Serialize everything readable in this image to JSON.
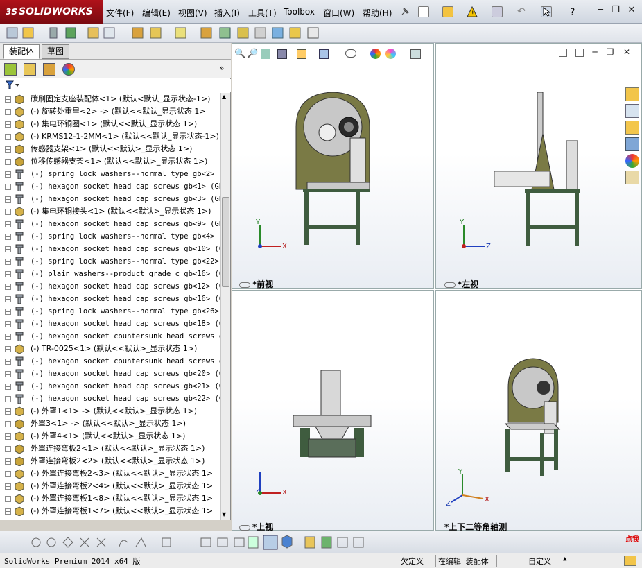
{
  "app": {
    "logo_prefix": "3S",
    "logo_name": "SOLIDWORKS"
  },
  "menu": [
    "文件(F)",
    "编辑(E)",
    "视图(V)",
    "插入(I)",
    "工具(T)",
    "Toolbox",
    "窗口(W)",
    "帮助(H)"
  ],
  "help_glyph": "?",
  "tabs": [
    "装配体",
    "草图"
  ],
  "tree": [
    {
      "label": "碳刷固定支座装配体<1> (默认<默认_显示状态-1>)",
      "icon": "assembly",
      "mono": false
    },
    {
      "label": "(-) 旋转处重里<2> -> (默认<<默认_显示状态 1>",
      "icon": "part",
      "mono": false
    },
    {
      "label": "(-) 集电环铜圈<1> (默认<<默认_显示状态 1>)",
      "icon": "part",
      "mono": false
    },
    {
      "label": "(-) KRMS12-1-2MM<1> (默认<<默认_显示状态-1>)",
      "icon": "part",
      "mono": false
    },
    {
      "label": "传感器支架<1> (默认<<默认>_显示状态 1>)",
      "icon": "assembly",
      "mono": false
    },
    {
      "label": "位移传感器支架<1> (默认<<默认>_显示状态 1>)",
      "icon": "assembly",
      "mono": false
    },
    {
      "label": "(-) spring lock washers--normal type gb<2> (GB",
      "icon": "screw",
      "mono": true
    },
    {
      "label": "(-) hexagon socket head cap screws gb<1> (GB_I",
      "icon": "screw",
      "mono": true
    },
    {
      "label": "(-) hexagon socket head cap screws gb<3> (GB_I",
      "icon": "screw",
      "mono": true
    },
    {
      "label": "(-) 集电环铜接头<1> (默认<<默认>_显示状态 1>)",
      "icon": "part",
      "mono": false
    },
    {
      "label": "(-) hexagon socket head cap screws gb<9> (GB_I",
      "icon": "screw",
      "mono": true
    },
    {
      "label": "(-) spring lock washers--normal type gb<4> (GI",
      "icon": "screw",
      "mono": true
    },
    {
      "label": "(-) hexagon socket head cap screws gb<10> (GB_",
      "icon": "screw",
      "mono": true
    },
    {
      "label": "(-) spring lock washers--normal type gb<22> (",
      "icon": "screw",
      "mono": true
    },
    {
      "label": "(-) plain washers--product grade c gb<16> (GB_",
      "icon": "screw",
      "mono": true
    },
    {
      "label": "(-) hexagon socket head cap screws gb<12> (GB_",
      "icon": "screw",
      "mono": true
    },
    {
      "label": "(-) hexagon socket head cap screws gb<16> (GB_",
      "icon": "screw",
      "mono": true
    },
    {
      "label": "(-) spring lock washers--normal type gb<26> (",
      "icon": "screw",
      "mono": true
    },
    {
      "label": "(-) hexagon socket head cap screws gb<18> (GB_",
      "icon": "screw",
      "mono": true
    },
    {
      "label": "(-) hexagon socket countersunk head screws gb<",
      "icon": "screw",
      "mono": true
    },
    {
      "label": "(-) TR-0025<1> (默认<<默认>_显示状态 1>)",
      "icon": "part",
      "mono": false
    },
    {
      "label": "(-) hexagon socket countersunk head screws gb<",
      "icon": "screw",
      "mono": true
    },
    {
      "label": "(-) hexagon socket head cap screws gb<20> (GB_",
      "icon": "screw",
      "mono": true
    },
    {
      "label": "(-) hexagon socket head cap screws gb<21> (GB_",
      "icon": "screw",
      "mono": true
    },
    {
      "label": "(-) hexagon socket head cap screws gb<22> (GB_",
      "icon": "screw",
      "mono": true
    },
    {
      "label": "(-) 外罩1<1> -> (默认<<默认>_显示状态 1>)",
      "icon": "part",
      "mono": false
    },
    {
      "label": "外罩3<1> -> (默认<<默认>_显示状态 1>)",
      "icon": "assembly",
      "mono": false
    },
    {
      "label": "(-) 外罩4<1> (默认<<默认>_显示状态 1>)",
      "icon": "part",
      "mono": false
    },
    {
      "label": "外罩连接弯板2<1> (默认<<默认>_显示状态 1>)",
      "icon": "assembly",
      "mono": false
    },
    {
      "label": "外罩连接弯板2<2> (默认<<默认>_显示状态 1>)",
      "icon": "assembly",
      "mono": false
    },
    {
      "label": "(-) 外罩连接弯板2<3> (默认<<默认>_显示状态 1>",
      "icon": "part",
      "mono": false
    },
    {
      "label": "(-) 外罩连接弯板2<4> (默认<<默认>_显示状态 1>",
      "icon": "part",
      "mono": false
    },
    {
      "label": "(-) 外罩连接弯板1<8> (默认<<默认>_显示状态 1>",
      "icon": "part",
      "mono": false
    },
    {
      "label": "(-) 外罩连接弯板1<7> (默认<<默认>_显示状态 1>",
      "icon": "part",
      "mono": false
    }
  ],
  "viewports": [
    {
      "label": "*前视",
      "axes": [
        "Y",
        "X"
      ]
    },
    {
      "label": "*左视",
      "axes": [
        "Y",
        "Z"
      ]
    },
    {
      "label": "*上视",
      "axes": [
        "Z",
        "X"
      ]
    },
    {
      "label": "*上下二等角轴测",
      "axes": [
        "Y",
        "Z",
        "X"
      ]
    }
  ],
  "status": {
    "product": "SolidWorks Premium 2014 x64 版",
    "state1": "欠定义",
    "state2": "在编辑 装配体",
    "custom": "自定义",
    "corner": "点我"
  },
  "colors": {
    "brand": "#a3121a",
    "model": "#6b6b34",
    "frame": "#3f5c3f"
  }
}
